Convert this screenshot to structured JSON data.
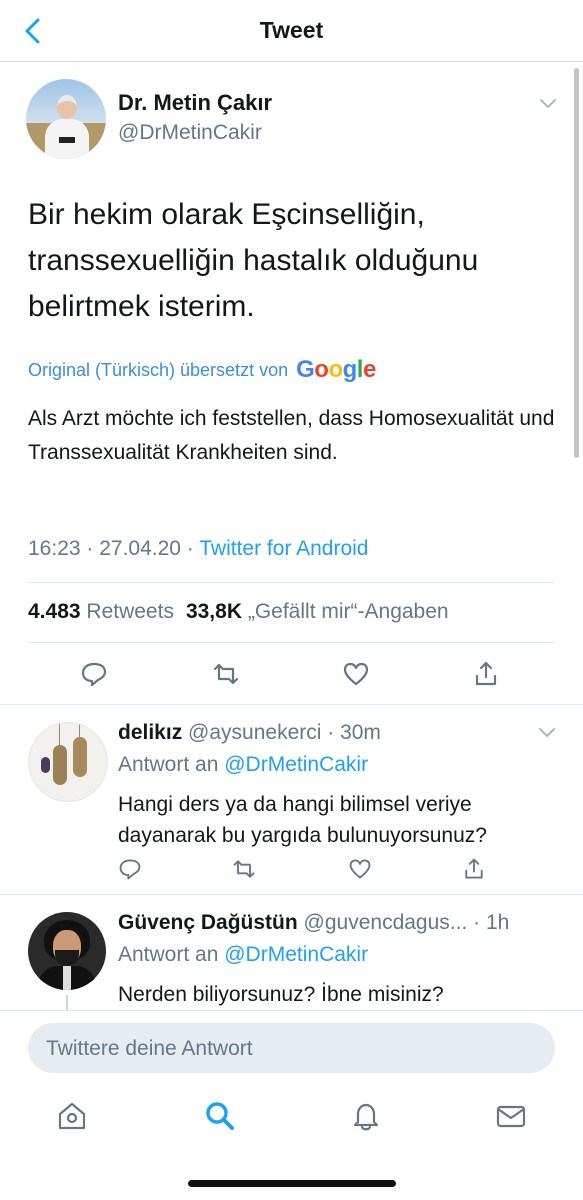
{
  "header": {
    "title": "Tweet"
  },
  "main_tweet": {
    "author_name": "Dr. Metin Çakır",
    "author_handle": "@DrMetinCakir",
    "text": "Bir hekim olarak Eşcinselliğin, transsexuelliğin hastalık olduğunu belirtmek isterim.",
    "translation_label": "Original (Türkisch) übersetzt von",
    "translation_brand": "Google",
    "translation_text": "Als Arzt möchte ich feststellen, dass Homosexualität und Transsexualität Krankheiten sind.",
    "timestamp": "16:23 · 27.04.20 · ",
    "source": "Twitter for Android",
    "retweets_count": "4.483",
    "retweets_label": "Retweets",
    "likes_count": "33,8K",
    "likes_label": "„Gefällt mir“-Angaben"
  },
  "replies": [
    {
      "name": "delikız",
      "handle_time": " @aysunekerci · 30m",
      "reply_to_label": "Antwort an ",
      "reply_to_handle": "@DrMetinCakir",
      "text": "Hangi ders ya da hangi bilimsel veriye dayanarak bu yargıda bulunuyorsunuz?"
    },
    {
      "name": "Güvenç Dağüstün",
      "handle_time": " @guvencdagus... · 1h",
      "reply_to_label": "Antwort an ",
      "reply_to_handle": "@DrMetinCakir",
      "text": "Nerden biliyorsunuz? İbne misiniz?"
    }
  ],
  "compose": {
    "placeholder": "Twittere deine Antwort"
  },
  "tabs": [
    "home-icon",
    "search-icon",
    "notifications-icon",
    "messages-icon"
  ],
  "colors": {
    "accent": "#1da1f2",
    "secondary_text": "#657786",
    "primary_text": "#14171a"
  }
}
